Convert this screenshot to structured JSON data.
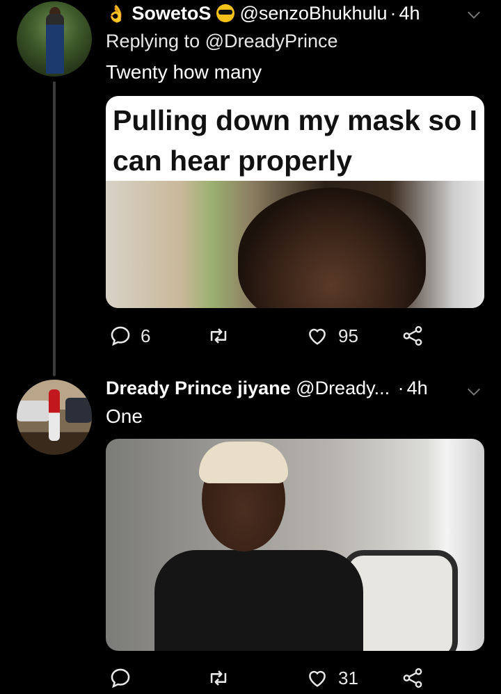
{
  "tweets": [
    {
      "display_name": "SowetoS",
      "handle": "@senzoBhukhulu",
      "time": "4h",
      "replying_to": "Replying to @DreadyPrince",
      "text": "Twenty how many",
      "meme_caption": "Pulling down my mask so I can hear properly",
      "replies": "6",
      "retweets": "",
      "likes": "95"
    },
    {
      "display_name": "Dready Prince jiyane",
      "handle": "@Dready...",
      "time": "4h",
      "text": "One",
      "replies": "",
      "retweets": "",
      "likes": "31"
    }
  ],
  "separator": "·",
  "icons": {
    "reply": "reply-icon",
    "retweet": "retweet-icon",
    "like": "like-icon",
    "share": "share-icon",
    "more": "chevron-down-icon"
  },
  "colors": {
    "background": "#000000",
    "text": "#ffffff",
    "icon": "#e8e8e8",
    "thread_line": "#3b3b3b"
  }
}
